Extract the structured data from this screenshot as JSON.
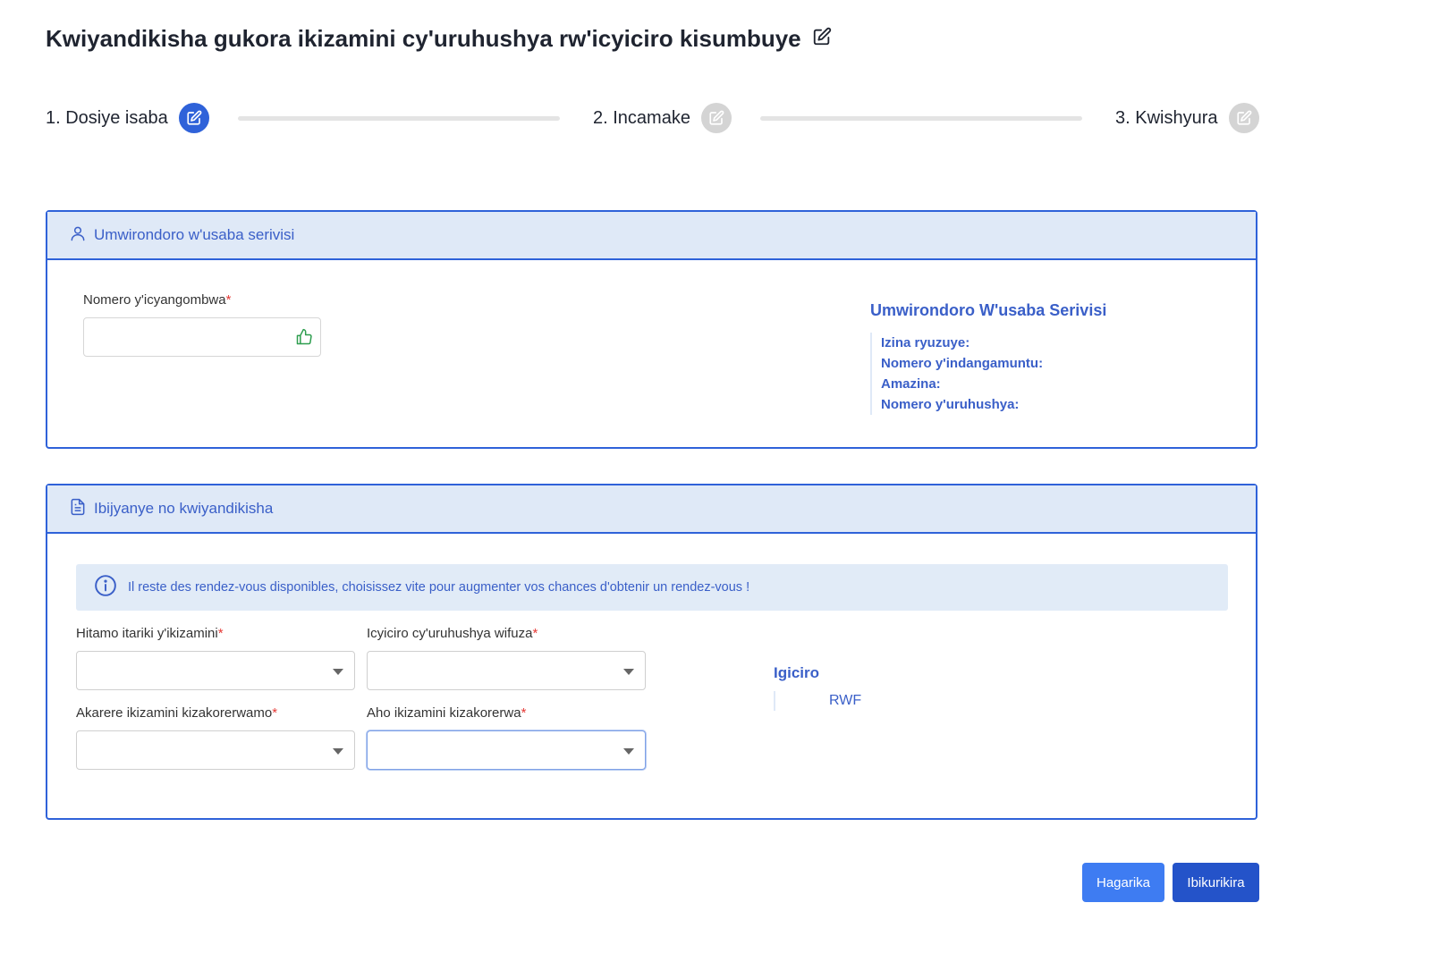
{
  "page": {
    "title": "Kwiyandikisha gukora ikizamini cy'uruhushya rw'icyiciro kisumbuye",
    "title_icon": "edit-icon"
  },
  "stepper": {
    "steps": [
      {
        "label": "1. Dosiye isaba",
        "state": "active",
        "icon": "edit-icon"
      },
      {
        "label": "2. Incamake",
        "state": "inactive",
        "icon": "edit-icon"
      },
      {
        "label": "3. Kwishyura",
        "state": "inactive",
        "icon": "edit-icon"
      }
    ]
  },
  "applicant_section": {
    "header": "Umwirondoro w'usaba serivisi",
    "header_icon": "user-icon",
    "permit_number_label": "Nomero y'icyangombwa",
    "permit_number_required": "*",
    "permit_number_value": "",
    "validated_icon": "thumbs-up-icon",
    "info_title": "Umwirondoro W'usaba Serivisi",
    "info_rows": [
      {
        "label": "Izina ryuzuye:",
        "value": ""
      },
      {
        "label": "Nomero y'indangamuntu:",
        "value": ""
      },
      {
        "label": "Amazina:",
        "value": ""
      },
      {
        "label": "Nomero y'uruhushya:",
        "value": ""
      }
    ]
  },
  "exam_section": {
    "header": "Ibijyanye no kwiyandikisha",
    "header_icon": "document-icon",
    "alert_icon": "info-icon",
    "alert_text": "Il reste des rendez-vous disponibles, choisissez vite pour augmenter vos chances d'obtenir un rendez-vous !",
    "fields": {
      "date": {
        "label": "Hitamo itariki y'ikizamini",
        "required": "*",
        "value": ""
      },
      "category": {
        "label": "Icyiciro cy'uruhushya wifuza",
        "required": "*",
        "value": ""
      },
      "district": {
        "label": "Akarere ikizamini kizakorerwamo",
        "required": "*",
        "value": ""
      },
      "location": {
        "label": "Aho ikizamini kizakorerwa",
        "required": "*",
        "value": ""
      }
    },
    "price_title": "Igiciro",
    "price_currency": "RWF"
  },
  "actions": {
    "cancel_label": "Hagarika",
    "submit_label": "Ibikurikira"
  },
  "colors": {
    "primary": "#2f62d9",
    "header_bg": "#dfe9f7",
    "text_accent": "#3a5fc8",
    "required": "#e53935",
    "success": "#2e9e4f"
  }
}
